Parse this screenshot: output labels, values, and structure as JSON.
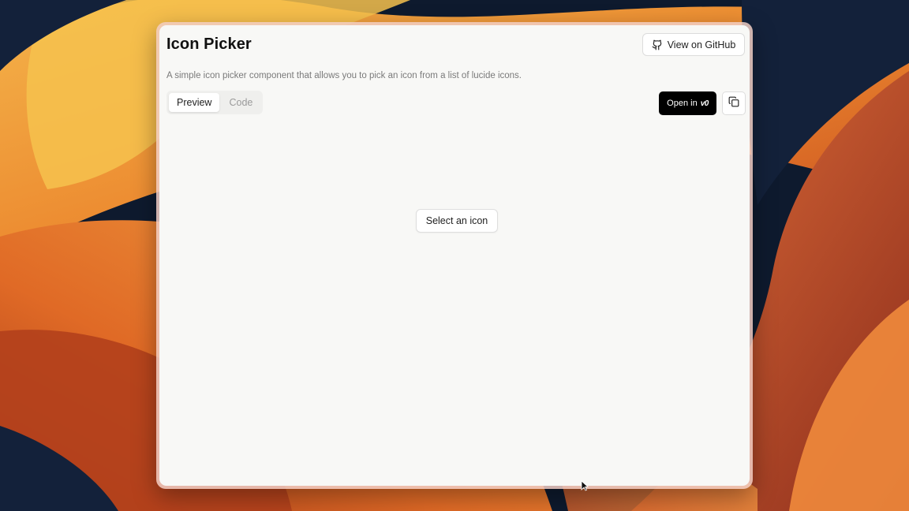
{
  "app": {
    "title": "Icon Picker",
    "description": "A simple icon picker component that allows you to pick an icon from a list of lucide icons."
  },
  "header": {
    "github_button_label": "View on GitHub",
    "github_icon": "github-icon"
  },
  "tabs": [
    {
      "label": "Preview",
      "active": true
    },
    {
      "label": "Code",
      "active": false
    }
  ],
  "toolbar": {
    "open_in_label": "Open in",
    "open_in_logo": "v0",
    "copy_icon": "copy-icon"
  },
  "preview": {
    "select_button_label": "Select an icon"
  },
  "colors": {
    "panel_bg": "#f8f8f6",
    "primary_button_bg": "#000000",
    "muted_text": "#7a7a7a",
    "wallpaper_orange": "#e8762a",
    "wallpaper_dark": "#0e1a2e"
  }
}
